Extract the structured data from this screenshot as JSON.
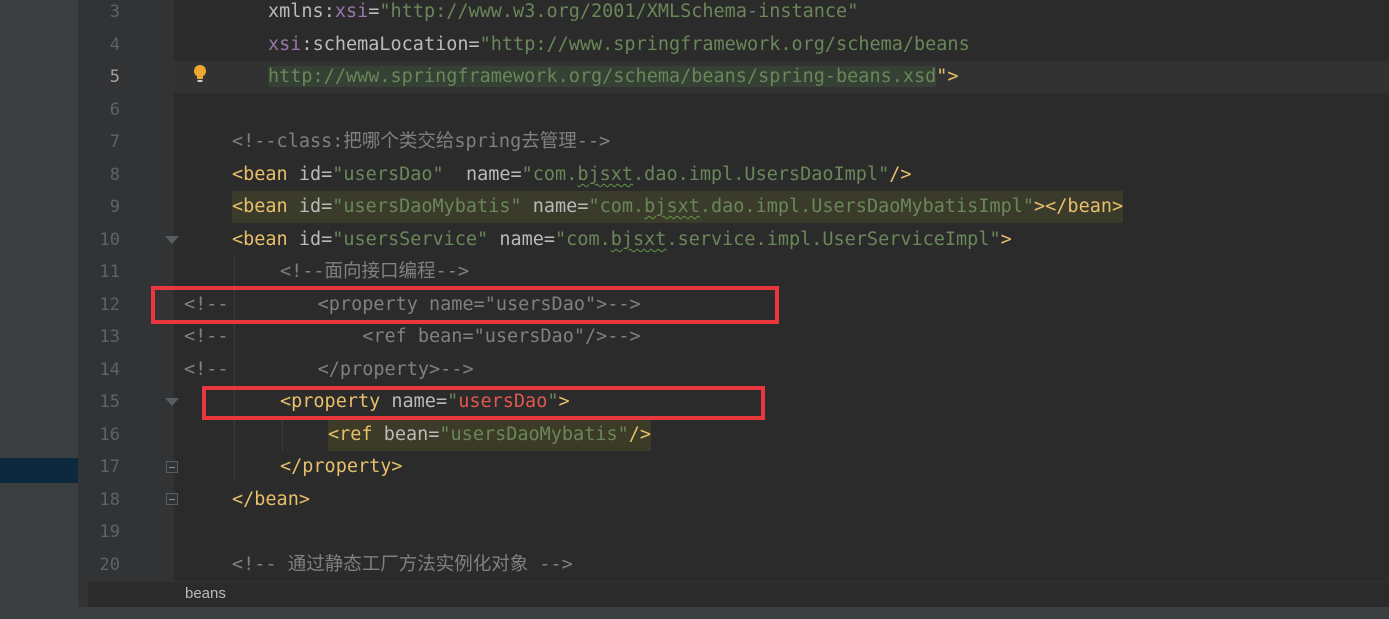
{
  "lines": [
    {
      "n": "3"
    },
    {
      "n": "4"
    },
    {
      "n": "5"
    },
    {
      "n": "6"
    },
    {
      "n": "7"
    },
    {
      "n": "8"
    },
    {
      "n": "9"
    },
    {
      "n": "10"
    },
    {
      "n": "11"
    },
    {
      "n": "12"
    },
    {
      "n": "13"
    },
    {
      "n": "14"
    },
    {
      "n": "15"
    },
    {
      "n": "16"
    },
    {
      "n": "17"
    },
    {
      "n": "18"
    },
    {
      "n": "19"
    },
    {
      "n": "20"
    }
  ],
  "code": {
    "l3": {
      "ns": "xmlns",
      "colon": ":",
      "attr": "xsi",
      "eq": "=",
      "val": "\"http://www.w3.org/2001/XMLSchema-instance\""
    },
    "l4": {
      "ns": "xsi",
      "colon": ":",
      "attr": "schemaLocation",
      "eq": "=",
      "val": "\"http://www.springframework.org/schema/beans"
    },
    "l5": {
      "url": "http://www.springframework.org/schema/beans/spring-beans.xsd",
      "end": "\">"
    },
    "l7": {
      "comment": "<!--class:把哪个类交给spring去管理-->"
    },
    "l8": {
      "open": "<bean",
      "a1": "id",
      "v1": "\"usersDao\"",
      "a2": "name",
      "v2a": "\"com.",
      "v2sq": "bjsxt",
      "v2b": ".dao.impl.UsersDaoImpl\"",
      "close": "/>"
    },
    "l9": {
      "open": "<bean",
      "a1": "id",
      "v1": "\"usersDaoMybatis\"",
      "a2": "name",
      "v2a": "\"com.",
      "v2sq": "bjsxt",
      "v2b": ".dao.impl.UsersDaoMybatisImpl\"",
      "close": "></bean>"
    },
    "l10": {
      "open": "<bean",
      "a1": "id",
      "v1": "\"usersService\"",
      "a2": "name",
      "v2a": "\"com.",
      "v2sq": "bjsxt",
      "v2b": ".service.impl.UserServiceImpl\"",
      "close": ">"
    },
    "l11": {
      "comment": "<!--面向接口编程-->"
    },
    "l12": {
      "text": "<!--        <property name=\"usersDao\">-->"
    },
    "l13": {
      "text": "<!--            <ref bean=\"usersDao\"/>-->"
    },
    "l14": {
      "text": "<!--        </property>-->"
    },
    "l15": {
      "open": "<property",
      "a1": "name",
      "eq": "=",
      "q1": "\"",
      "v1": "usersDao",
      "q2": "\"",
      "close": ">"
    },
    "l16": {
      "open": "<ref",
      "a1": "bean",
      "v1": "\"usersDaoMybatis\"",
      "close": "/>"
    },
    "l17": {
      "text": "</property>"
    },
    "l18": {
      "text": "</bean>"
    },
    "l20": {
      "comment": "<!-- 通过静态工厂方法实例化对象 -->"
    }
  },
  "breadcrumb": {
    "label": "beans"
  },
  "icons": {
    "bulb": "lightbulb-icon",
    "fold": "fold-marker-icon"
  }
}
